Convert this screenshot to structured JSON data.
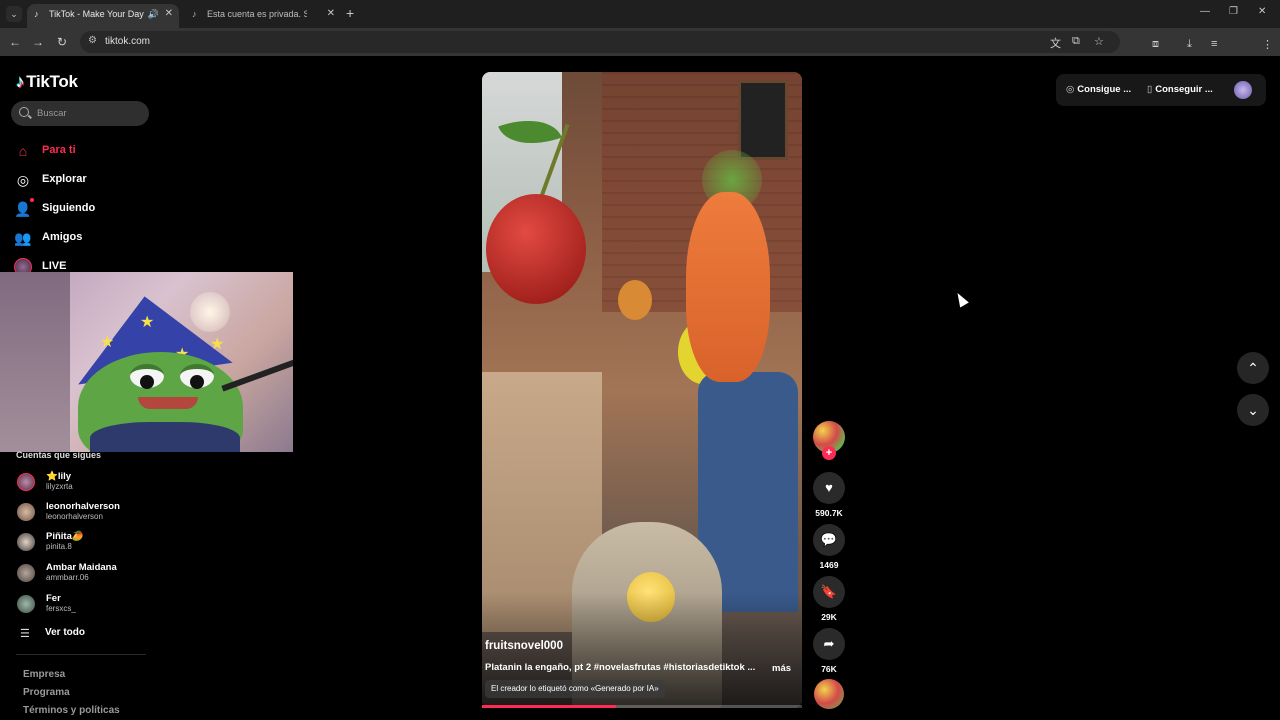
{
  "browser": {
    "tabs": [
      {
        "title": "TikTok - Make Your Day",
        "active": true,
        "icon": "tiktok-icon"
      },
      {
        "title": "Esta cuenta es privada. Sigue e",
        "active": false,
        "icon": "tiktok-icon"
      }
    ],
    "url": "tiktok.com"
  },
  "sidebar": {
    "logo": "TikTok",
    "search_placeholder": "Buscar",
    "nav": [
      {
        "label": "Para ti",
        "icon": "home-icon",
        "active": true
      },
      {
        "label": "Explorar",
        "icon": "compass-icon"
      },
      {
        "label": "Siguiendo",
        "icon": "user-follow-icon"
      },
      {
        "label": "Amigos",
        "icon": "friends-icon"
      },
      {
        "label": "LIVE",
        "icon": "live-avatar"
      }
    ],
    "following_header": "Cuentas que sigues",
    "accounts": [
      {
        "name": "⭐lily",
        "handle": "lilyzxrta"
      },
      {
        "name": "leonorhalverson",
        "handle": "leonorhalverson"
      },
      {
        "name": "Piñita🥭",
        "handle": "pinita.8"
      },
      {
        "name": "Ambar Maidana",
        "handle": "ammbarr.06"
      },
      {
        "name": "Fer",
        "handle": "fersxcs_"
      }
    ],
    "see_all": "Ver todo",
    "footer": [
      "Empresa",
      "Programa",
      "Términos y políticas"
    ]
  },
  "video": {
    "username": "fruitsnovel000",
    "description": "Platanin la engaño, pt 2 #novelasfrutas #historiasdetiktok ...",
    "more": "más",
    "ai_label": "El creador lo etiquetó como «Generado por IA»",
    "progress": 0.42
  },
  "actions": {
    "likes": "590.7K",
    "comments": "1469",
    "saves": "29K",
    "shares": "76K"
  },
  "topright": {
    "coins_label": "Consigue ...",
    "app_label": "Conseguir ..."
  }
}
